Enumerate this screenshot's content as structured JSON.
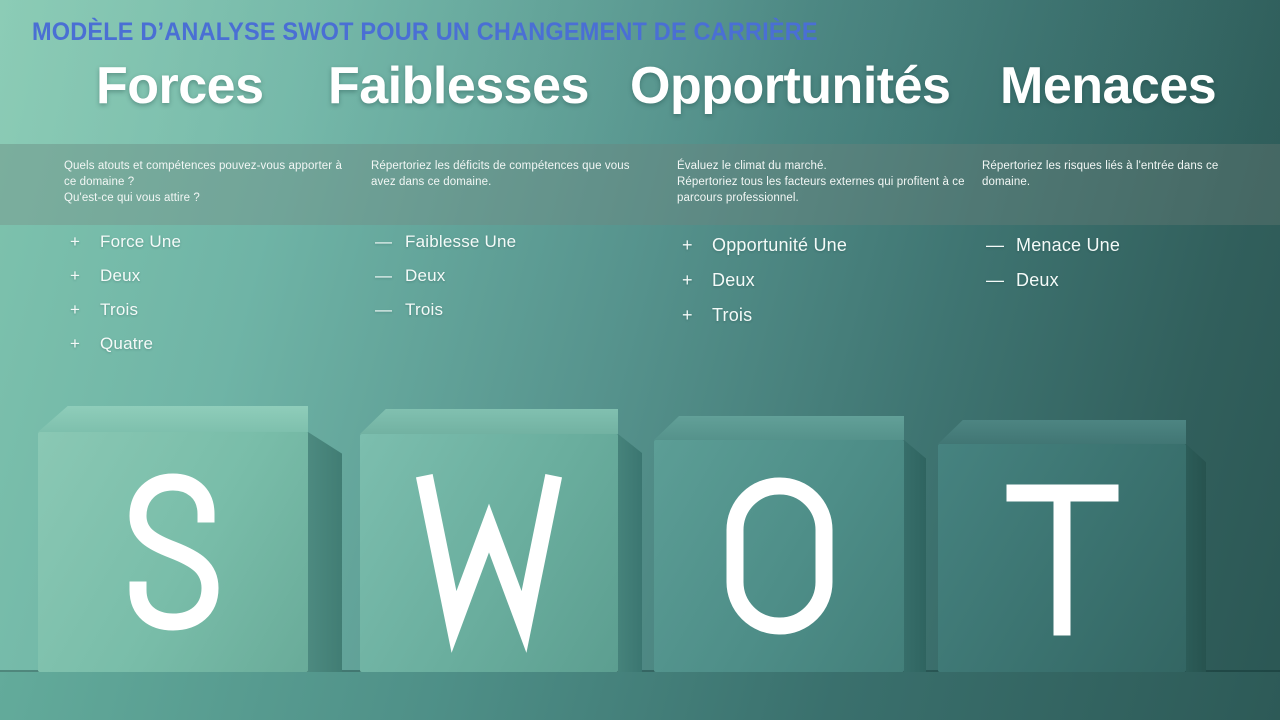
{
  "slide": {
    "title": "MODÈLE D’ANALYSE SWOT POUR UN CHANGEMENT DE CARRIÈRE",
    "title_color": "#4a6fd4",
    "background_colors": {
      "top_left": "#7fc4ae",
      "top_right": "#2f5d5a",
      "band": "#78807c"
    }
  },
  "quadrants": [
    {
      "heading": "Forces",
      "description": "Quels atouts et compétences pouvez-vous apporter à ce domaine ?\nQu'est-ce qui vous attire ?",
      "bullet_mark": "+",
      "items": [
        "Force Une",
        "Deux",
        "Trois",
        "Quatre"
      ]
    },
    {
      "heading": "Faiblesses",
      "description": "Répertoriez les déficits de compétences que vous avez dans ce domaine.",
      "bullet_mark": "—",
      "items": [
        "Faiblesse Une",
        "Deux",
        "Trois"
      ]
    },
    {
      "heading": "Opportunités",
      "description": "Évaluez le climat du marché.\nRépertoriez tous les facteurs externes qui profitent à ce parcours professionnel.",
      "bullet_mark": "+",
      "items": [
        "Opportunité Une",
        "Deux",
        "Trois"
      ]
    },
    {
      "heading": "Menaces",
      "description": "Répertoriez les risques liés à l'entrée dans ce domaine.",
      "bullet_mark": "—",
      "items": [
        "Menace Une",
        "Deux"
      ]
    }
  ],
  "cubes": [
    {
      "letter": "S",
      "face": "#79bda9",
      "top": "#8fcdba",
      "side": "#417d74"
    },
    {
      "letter": "W",
      "face": "#6aae9e",
      "top": "#81c0b0",
      "side": "#3b7671"
    },
    {
      "letter": "O",
      "face": "#4e8e88",
      "top": "#62a098",
      "side": "#2f6460"
    },
    {
      "letter": "T",
      "face": "#3b7370",
      "top": "#4d8582",
      "side": "#27534f"
    }
  ]
}
